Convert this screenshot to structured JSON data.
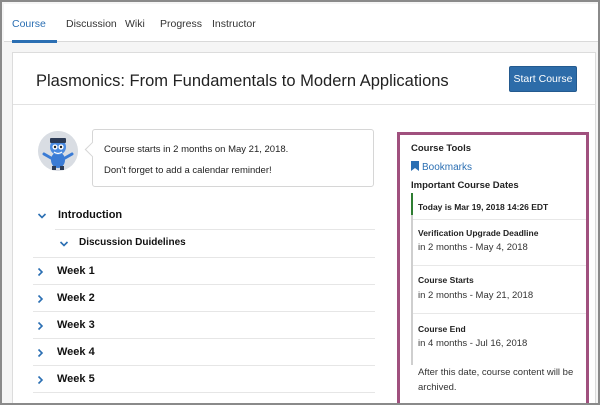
{
  "tabs": [
    {
      "label": "Course",
      "active": true
    },
    {
      "label": "Discussion",
      "active": false
    },
    {
      "label": "Wiki",
      "active": false
    },
    {
      "label": "Progress",
      "active": false
    },
    {
      "label": "Instructor",
      "active": false
    }
  ],
  "course": {
    "title": "Plasmonics: From Fundamentals to Modern Applications",
    "start_button": "Start Course"
  },
  "message": {
    "line1": "Course starts in 2 months on May 21, 2018.",
    "line2": "Don't forget to add a calendar reminder!"
  },
  "outline": {
    "sections": [
      {
        "label": "Introduction",
        "expanded": true,
        "subsections": [
          {
            "label": "Discussion Duidelines",
            "expanded": true
          }
        ]
      },
      {
        "label": "Week 1",
        "expanded": false
      },
      {
        "label": "Week 2",
        "expanded": false
      },
      {
        "label": "Week 3",
        "expanded": false
      },
      {
        "label": "Week 4",
        "expanded": false
      },
      {
        "label": "Week 5",
        "expanded": false
      }
    ]
  },
  "sidebar": {
    "tools_heading": "Course Tools",
    "bookmarks_label": "Bookmarks",
    "dates_heading": "Important Course Dates",
    "today": "Today is Mar 19, 2018 14:26 EDT",
    "dates": [
      {
        "title": "Verification Upgrade Deadline",
        "value": "in 2 months - May 4, 2018"
      },
      {
        "title": "Course Starts",
        "value": "in 2 months - May 21, 2018"
      },
      {
        "title": "Course End",
        "value": "in 4 months - Jul 16, 2018"
      }
    ],
    "archive_note_line1": "After this date, course content will be",
    "archive_note_line2": "archived."
  },
  "colors": {
    "accent": "#2b6fb3",
    "button": "#2d6ca9",
    "sidebar_border": "#a0507e",
    "active_date_marker": "#2e7d32"
  },
  "icons": {
    "expand": "chevron-down-icon",
    "collapsed": "chevron-right-icon",
    "bookmark": "bookmark-icon",
    "avatar": "mascot-icon"
  }
}
